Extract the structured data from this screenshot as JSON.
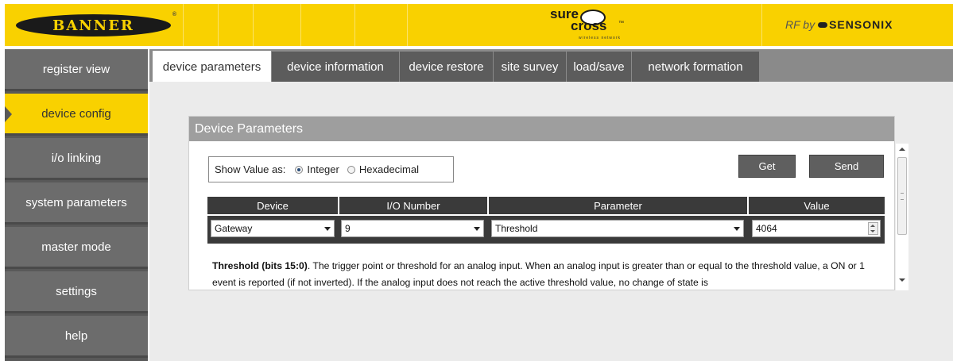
{
  "header": {
    "logo_banner": "BANNER",
    "logo_registered": "®",
    "logo_sure": "sure",
    "logo_cross": "cross",
    "logo_tm": "™",
    "logo_sub": "wireless network",
    "rf_by": "RF by",
    "sensonix": "SENSONIX",
    "colors": {
      "brand_yellow": "#f9d100",
      "dark": "#1a1a1a"
    }
  },
  "sidebar": {
    "items": [
      {
        "label": "register view",
        "active": false
      },
      {
        "label": "device config",
        "active": true
      },
      {
        "label": "i/o linking",
        "active": false
      },
      {
        "label": "system parameters",
        "active": false
      },
      {
        "label": "master mode",
        "active": false
      },
      {
        "label": "settings",
        "active": false
      },
      {
        "label": "help",
        "active": false
      }
    ]
  },
  "tabs": [
    {
      "label": "device parameters",
      "active": true
    },
    {
      "label": "device information",
      "active": false
    },
    {
      "label": "device restore",
      "active": false
    },
    {
      "label": "site survey",
      "active": false
    },
    {
      "label": "load/save",
      "active": false
    },
    {
      "label": "network formation",
      "active": false
    }
  ],
  "panel": {
    "title": "Device Parameters",
    "show_value_label": "Show Value as:",
    "radio_integer": "Integer",
    "radio_hex": "Hexadecimal",
    "selected_format": "Integer",
    "get_label": "Get",
    "send_label": "Send",
    "table": {
      "headers": [
        "Device",
        "I/O Number",
        "Parameter",
        "Value"
      ],
      "row": {
        "device": "Gateway",
        "io_number": "9",
        "parameter": "Threshold",
        "value": "4064"
      }
    },
    "description": {
      "bold": "Threshold (bits 15:0)",
      "text": ". The trigger point or threshold for an analog input. When an analog input is greater than or equal to the threshold value, a ON or 1 event is reported (if not inverted). If the analog input does not reach the active threshold value, no change of state is"
    }
  }
}
